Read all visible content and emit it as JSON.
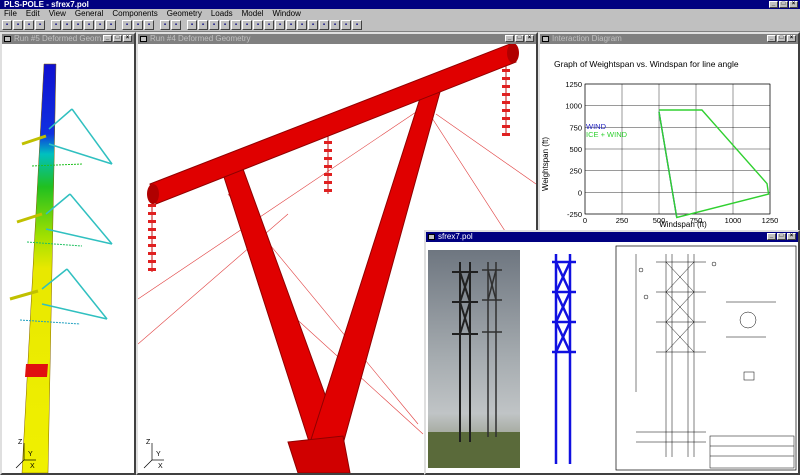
{
  "app": {
    "title": "PLS-POLE - sfrex7.pol"
  },
  "menu": [
    "File",
    "Edit",
    "View",
    "General",
    "Components",
    "Geometry",
    "Loads",
    "Model",
    "Window"
  ],
  "toolbar_icons": [
    "new-icon",
    "open-icon",
    "save-icon",
    "print-icon",
    "sep",
    "zoom-in-icon",
    "zoom-out-icon",
    "zoom-extents-icon",
    "pan-icon",
    "rotate-icon",
    "view-icon",
    "sep",
    "run-icon",
    "results-icon",
    "report-icon",
    "sep",
    "color-icon",
    "grid-icon",
    "sep",
    "tool-1-icon",
    "tool-2-icon",
    "tool-3-icon",
    "tool-4-icon",
    "tool-5-icon",
    "tool-6-icon",
    "tool-7-icon",
    "tool-8-icon",
    "tool-9-icon",
    "tool-10-icon",
    "tool-11-icon",
    "tool-12-icon",
    "tool-13-icon",
    "tool-14-icon",
    "tool-15-icon",
    "tool-16-icon"
  ],
  "windows": {
    "run5": {
      "title": "Run #5 Deformed Geom...",
      "axes": {
        "x": "X",
        "y": "Y",
        "z": "Z"
      }
    },
    "run4": {
      "title": "Run #4 Deformed Geometry",
      "axes": {
        "x": "X",
        "y": "Y",
        "z": "Z"
      }
    },
    "interaction": {
      "title": "Interaction Diagram"
    },
    "sfrex": {
      "title": "sfrex7.pol"
    }
  },
  "chart_data": {
    "type": "line",
    "title": "Graph of Weightspan vs. Windspan for line angle",
    "xlabel": "Windspan (ft)",
    "ylabel": "Weightspan (ft)",
    "xlim": [
      0,
      1250
    ],
    "ylim": [
      -250,
      1250
    ],
    "xticks": [
      "0",
      "250",
      "500",
      "750",
      "1000",
      "1250"
    ],
    "yticks": [
      "1250",
      "1000",
      "750",
      "500",
      "250",
      "0",
      "-250"
    ],
    "grid": true,
    "legend_position": "left",
    "series": [
      {
        "name": "WIND",
        "color": "#2020c0",
        "x": [
          500,
          620
        ],
        "y": [
          930,
          -290
        ]
      },
      {
        "name": "ICE + WIND",
        "color": "#30d030",
        "x": [
          500,
          790,
          1230,
          1240,
          620,
          500
        ],
        "y": [
          950,
          950,
          100,
          -20,
          -290,
          930
        ]
      }
    ]
  }
}
